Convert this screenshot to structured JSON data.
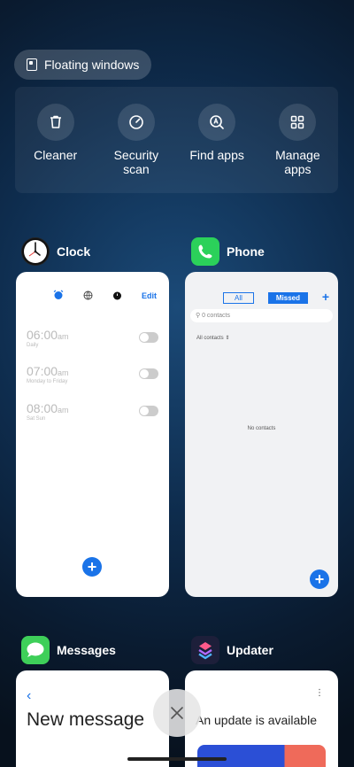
{
  "floating_windows": {
    "label": "Floating windows",
    "icon": "floating-window-icon"
  },
  "quick_actions": [
    {
      "label": "Cleaner",
      "icon": "trash-icon"
    },
    {
      "label": "Security scan",
      "icon": "gauge-icon"
    },
    {
      "label": "Find apps",
      "icon": "search-apps-icon"
    },
    {
      "label": "Manage apps",
      "icon": "grid-icon"
    }
  ],
  "apps": {
    "clock": {
      "name": "Clock",
      "edit_label": "Edit",
      "alarms": [
        {
          "time": "06:00",
          "ampm": "am",
          "sub": "Daily"
        },
        {
          "time": "07:00",
          "ampm": "am",
          "sub": "Monday to Friday"
        },
        {
          "time": "08:00",
          "ampm": "am",
          "sub": "Sat Sun"
        }
      ]
    },
    "phone": {
      "name": "Phone",
      "tab_all": "All",
      "tab_missed": "Missed",
      "search_placeholder": "0 contacts",
      "all_contacts": "All contacts",
      "no_contacts": "No contacts"
    },
    "messages": {
      "name": "Messages",
      "title": "New message"
    },
    "updater": {
      "name": "Updater",
      "title": "An update is available"
    }
  },
  "colors": {
    "accent": "#1a73e8",
    "phone_green": "#2bd15a",
    "messages_green": "#3ecf59"
  }
}
